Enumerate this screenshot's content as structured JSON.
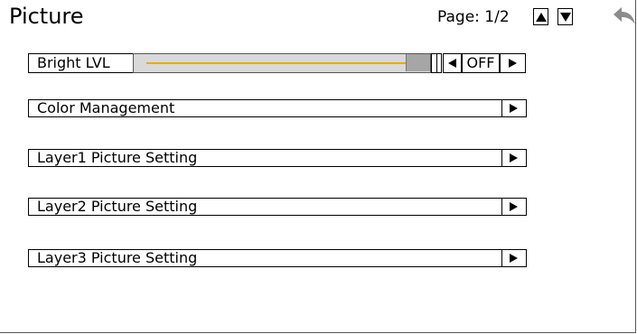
{
  "header": {
    "title": "Picture",
    "page_label": "Page:",
    "page_value": "1/2"
  },
  "icons": {
    "page_up": "triangle-up-icon",
    "page_down": "triangle-down-icon",
    "back": "back-arrow-icon"
  },
  "bright": {
    "label": "Bright LVL",
    "value": "OFF",
    "slider_level_fraction": 1.0,
    "slider_color": "#f0a800"
  },
  "menu": [
    {
      "label": "Color Management"
    },
    {
      "label": "Layer1 Picture Setting"
    },
    {
      "label": "Layer2 Picture Setting"
    },
    {
      "label": "Layer3 Picture Setting"
    }
  ]
}
